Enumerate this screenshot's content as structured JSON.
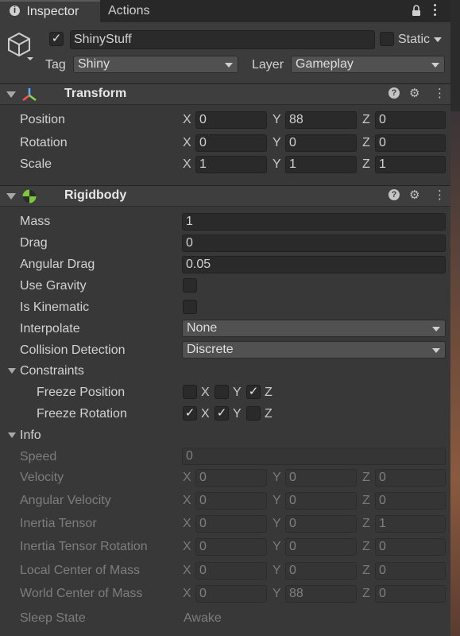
{
  "tabs": {
    "inspector": "Inspector",
    "actions": "Actions",
    "lock_icon": "lock-icon",
    "menu_icon": "kebab-menu-icon"
  },
  "header": {
    "object_active": true,
    "object_name": "ShinyStuff",
    "static_label": "Static",
    "static_checked": false,
    "tag_label": "Tag",
    "tag_value": "Shiny",
    "layer_label": "Layer",
    "layer_value": "Gameplay"
  },
  "transform": {
    "title": "Transform",
    "rows": [
      {
        "label": "Position",
        "x": "0",
        "y": "88",
        "z": "0"
      },
      {
        "label": "Rotation",
        "x": "0",
        "y": "0",
        "z": "0"
      },
      {
        "label": "Scale",
        "x": "1",
        "y": "1",
        "z": "1"
      }
    ]
  },
  "axes": {
    "x": "X",
    "y": "Y",
    "z": "Z"
  },
  "rigidbody": {
    "title": "Rigidbody",
    "mass_label": "Mass",
    "mass": "1",
    "drag_label": "Drag",
    "drag": "0",
    "angular_drag_label": "Angular Drag",
    "angular_drag": "0.05",
    "use_gravity_label": "Use Gravity",
    "use_gravity": false,
    "is_kinematic_label": "Is Kinematic",
    "is_kinematic": false,
    "interpolate_label": "Interpolate",
    "interpolate": "None",
    "collision_label": "Collision Detection",
    "collision": "Discrete",
    "constraints_label": "Constraints",
    "freeze_position_label": "Freeze Position",
    "freeze_rotation_label": "Freeze Rotation",
    "freeze_position": {
      "x": false,
      "y": false,
      "z": true
    },
    "freeze_rotation": {
      "x": true,
      "y": true,
      "z": false
    },
    "info_label": "Info",
    "speed_label": "Speed",
    "speed": "0",
    "info_rows": [
      {
        "label": "Velocity",
        "x": "0",
        "y": "0",
        "z": "0"
      },
      {
        "label": "Angular Velocity",
        "x": "0",
        "y": "0",
        "z": "0"
      },
      {
        "label": "Inertia Tensor",
        "x": "0",
        "y": "0",
        "z": "1"
      },
      {
        "label": "Inertia Tensor Rotation",
        "x": "0",
        "y": "0",
        "z": "0"
      },
      {
        "label": "Local Center of Mass",
        "x": "0",
        "y": "0",
        "z": "0"
      },
      {
        "label": "World Center of Mass",
        "x": "0",
        "y": "88",
        "z": "0"
      }
    ],
    "sleep_label": "Sleep State",
    "sleep": "Awake"
  },
  "check_glyph": "✓",
  "colors": {
    "background": "#383838",
    "field": "#2a2a2a",
    "dropdown": "#515151",
    "rigidbody_icon": "#7ec83c"
  }
}
